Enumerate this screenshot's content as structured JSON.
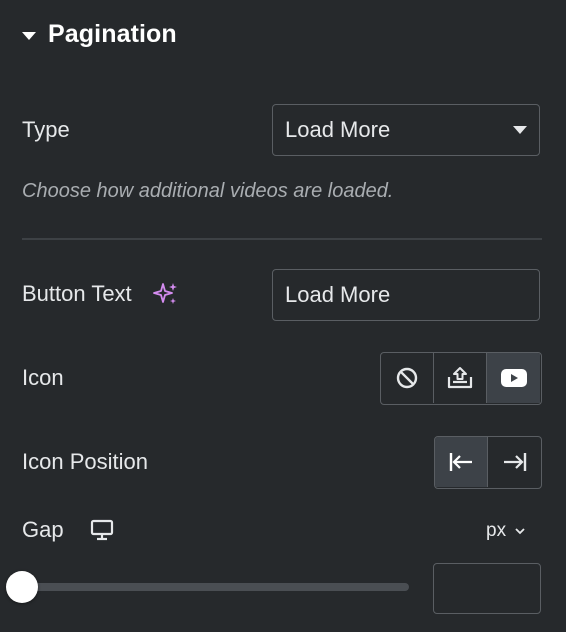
{
  "section": {
    "title": "Pagination"
  },
  "type": {
    "label": "Type",
    "selected": "Load More",
    "help": "Choose how additional videos are loaded."
  },
  "button_text": {
    "label": "Button Text",
    "value": "Load More"
  },
  "icon": {
    "label": "Icon",
    "options": [
      "none-icon",
      "upload-icon",
      "youtube-icon"
    ],
    "active_index": 2
  },
  "icon_position": {
    "label": "Icon Position",
    "options": [
      "align-start-icon",
      "align-end-icon"
    ],
    "active_index": 0
  },
  "gap": {
    "label": "Gap",
    "unit": "px",
    "value": "",
    "slider_fraction": 0
  },
  "colors": {
    "panel_bg": "#26292c",
    "border": "#5a5e63",
    "active_bg": "#3d4248",
    "ai_accent": "#d48cf0"
  }
}
